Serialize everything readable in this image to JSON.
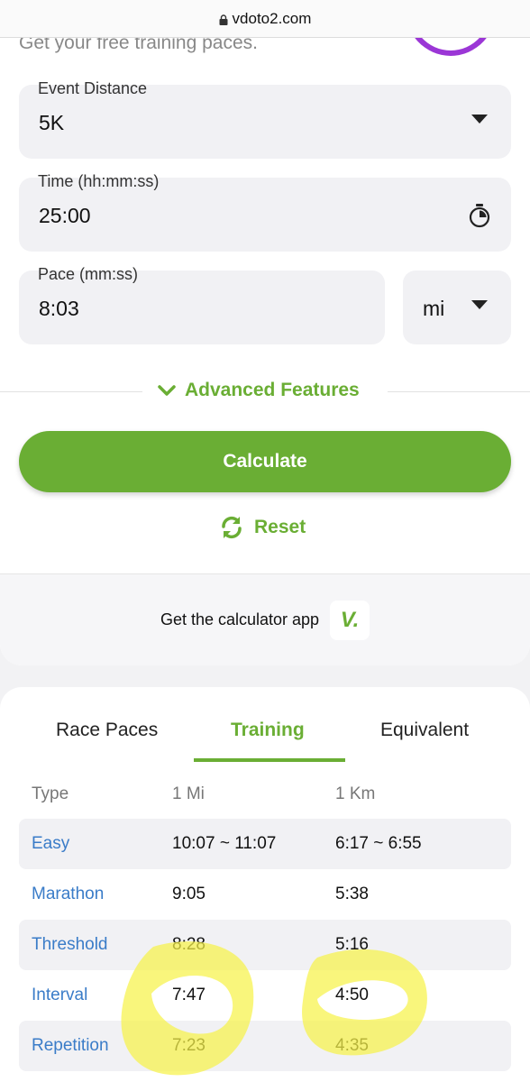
{
  "browser": {
    "url": "vdoto2.com"
  },
  "header": {
    "subtitle": "Get your free training paces."
  },
  "form": {
    "event_distance": {
      "label": "Event Distance",
      "value": "5K"
    },
    "time": {
      "label": "Time (hh:mm:ss)",
      "value": "25:00"
    },
    "pace": {
      "label": "Pace (mm:ss)",
      "value": "8:03"
    },
    "unit": {
      "value": "mi"
    }
  },
  "advanced_label": "Advanced Features",
  "calculate_label": "Calculate",
  "reset_label": "Reset",
  "app_promo": {
    "text": "Get the calculator app",
    "logo": "V."
  },
  "tabs": [
    {
      "label": "Race Paces",
      "active": false
    },
    {
      "label": "Training",
      "active": true
    },
    {
      "label": "Equivalent",
      "active": false
    }
  ],
  "table": {
    "headers": [
      "Type",
      "1 Mi",
      "1 Km"
    ],
    "rows": [
      {
        "type": "Easy",
        "mi": "10:07 ~ 11:07",
        "km": "6:17 ~ 6:55"
      },
      {
        "type": "Marathon",
        "mi": "9:05",
        "km": "5:38"
      },
      {
        "type": "Threshold",
        "mi": "8:28",
        "km": "5:16"
      },
      {
        "type": "Interval",
        "mi": "7:47",
        "km": "4:50"
      },
      {
        "type": "Repetition",
        "mi": "7:23",
        "km": "4:35"
      }
    ]
  },
  "colors": {
    "accent": "#6aae34",
    "link": "#3a7cc8",
    "highlighter": "#f6f24a",
    "logo_ring": "#9b36d6"
  }
}
